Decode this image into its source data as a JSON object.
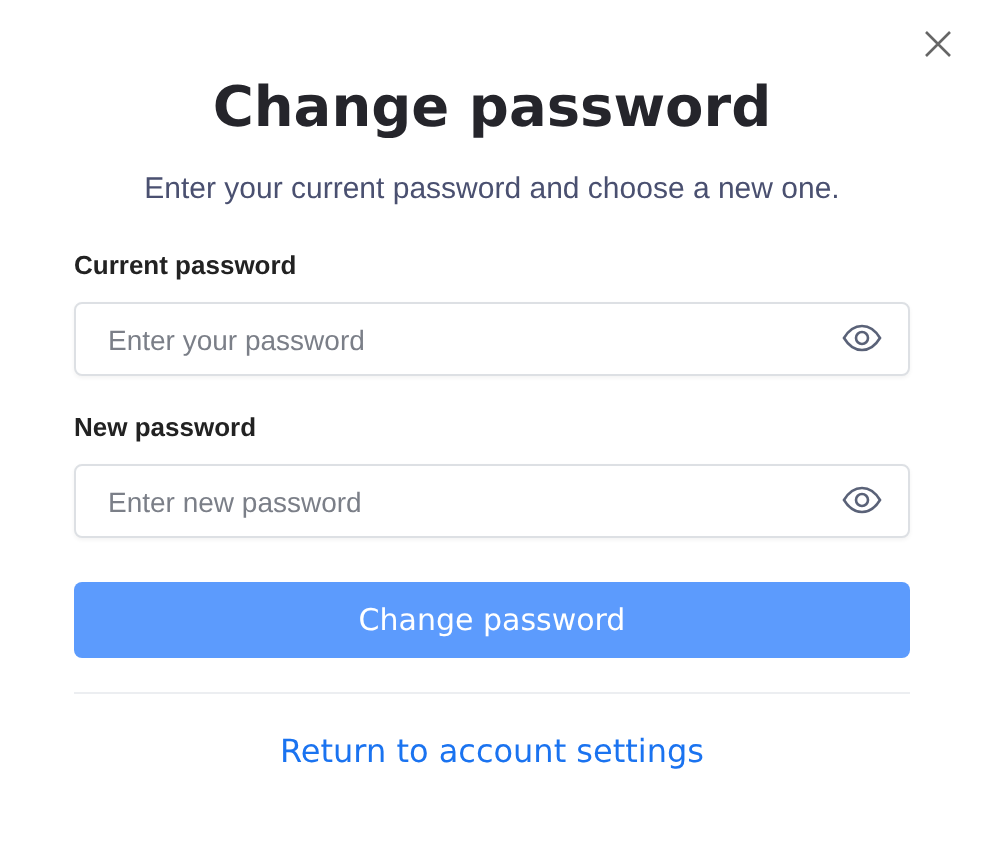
{
  "dialog": {
    "title": "Change password",
    "subtitle": "Enter your current password and choose a new one."
  },
  "fields": [
    {
      "label": "Current password",
      "placeholder": "Enter your password"
    },
    {
      "label": "New password",
      "placeholder": "Enter new password"
    }
  ],
  "submit": {
    "label": "Change password",
    "disabled": true
  },
  "link": "Return to account settings"
}
